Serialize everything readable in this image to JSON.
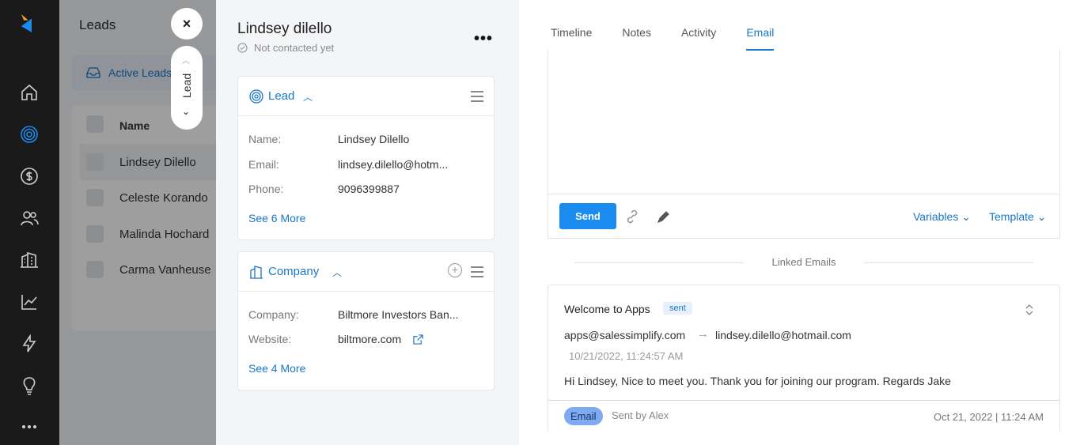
{
  "list": {
    "title": "Leads",
    "filter_label": "Active Leads",
    "column_name": "Name",
    "rows": [
      "Lindsey Dilello",
      "Celeste Korando",
      "Malinda Hochard",
      "Carma Vanheuse"
    ]
  },
  "side_tab": {
    "label": "Lead",
    "close": "×"
  },
  "detail": {
    "name": "Lindsey dilello",
    "status": "Not contacted yet",
    "more": "•••",
    "lead_card": {
      "title": "Lead",
      "fields": [
        {
          "label": "Name:",
          "value": "Lindsey Dilello"
        },
        {
          "label": "Email:",
          "value": "lindsey.dilello@hotm..."
        },
        {
          "label": "Phone:",
          "value": "9096399887"
        }
      ],
      "see_more": "See 6 More"
    },
    "company_card": {
      "title": "Company",
      "fields": [
        {
          "label": "Company:",
          "value": "Biltmore Investors Ban..."
        },
        {
          "label": "Website:",
          "value": "biltmore.com"
        }
      ],
      "see_more": "See 4 More"
    }
  },
  "tabs": [
    "Timeline",
    "Notes",
    "Activity",
    "Email"
  ],
  "active_tab": "Email",
  "composer": {
    "send": "Send",
    "variables": "Variables",
    "template": "Template"
  },
  "linked_emails_label": "Linked Emails",
  "email": {
    "subject": "Welcome to Apps",
    "badge": "sent",
    "from": "apps@salessimplify.com",
    "to": "lindsey.dilello@hotmail.com",
    "date": "10/21/2022, 11:24:57 AM",
    "body": "Hi Lindsey, Nice to meet you. Thank you for joining our program. Regards Jake",
    "type": "Email",
    "sent_by": "Sent by Alex",
    "timestamp": "Oct 21, 2022 | 11:24 AM"
  },
  "colors": {
    "accent": "#1877c9",
    "send": "#1a8cf0",
    "nav_bg": "#1a1a1a"
  }
}
